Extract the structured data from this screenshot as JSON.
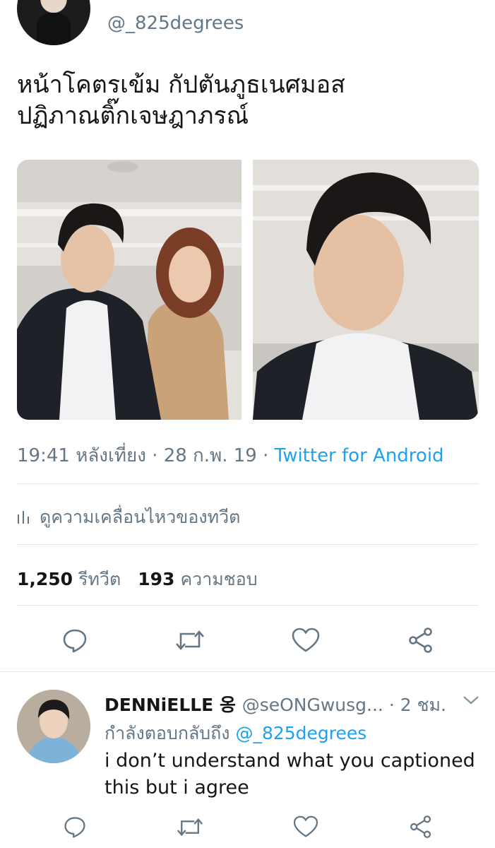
{
  "tweet": {
    "handle": "@_825degrees",
    "text_lines": [
      "หน้าโคตรเข้ม กัปตันภูธเนศมอส",
      "ปฏิภาณติ๊กเจษฎาภรณ์"
    ],
    "timestamp": "19:41 หลังเที่ยง · 28 ก.พ. 19 · ",
    "source": "Twitter for Android",
    "activity_label": "ดูความเคลื่อนไหวของทวีต",
    "retweet_count": "1,250",
    "retweet_label": "รีทวีต",
    "like_count": "193",
    "like_label": "ความชอบ",
    "actions": [
      "reply-icon",
      "retweet-icon",
      "like-icon",
      "share-icon"
    ]
  },
  "reply": {
    "name": "DENNiELLE 옹",
    "handle_time": "@seONGwusg... · 2 ชม.",
    "replying_prefix": "กำลังตอบกลับถึง ",
    "replying_to": "@_825degrees",
    "text_lines": [
      "i don’t understand what you captioned",
      "this but i agree"
    ]
  },
  "colors": {
    "accent": "#1da1f2",
    "secondary_text": "#657786",
    "divider": "#e1e8ed"
  }
}
